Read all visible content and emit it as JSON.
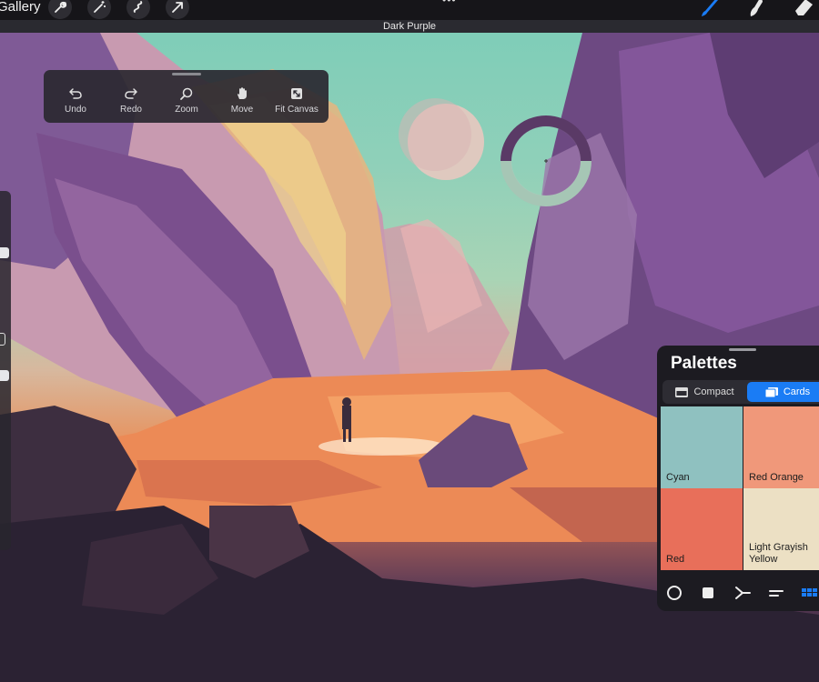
{
  "app": {
    "gallery_label": "Gallery",
    "layer_name": "Dark Purple",
    "more_label": "•••"
  },
  "topbar": {
    "left_tools": [
      "wrench-icon",
      "magic-wand-icon",
      "selection-icon",
      "transform-arrow-icon"
    ],
    "right_tools": [
      "brush-icon",
      "smudge-icon",
      "eraser-icon"
    ],
    "active_tool": "brush-icon",
    "accent_color": "#1a7cf5"
  },
  "quickbar": {
    "items": [
      {
        "label": "Undo",
        "icon": "undo-icon"
      },
      {
        "label": "Redo",
        "icon": "redo-icon"
      },
      {
        "label": "Zoom",
        "icon": "zoom-icon"
      },
      {
        "label": "Move",
        "icon": "hand-icon"
      },
      {
        "label": "Fit Canvas",
        "icon": "fit-canvas-icon"
      }
    ]
  },
  "color_picker": {
    "current_color": "#5a3a66",
    "previous_color": "#a6c6b5"
  },
  "palettes": {
    "title": "Palettes",
    "tabs": [
      {
        "label": "Compact",
        "active": false
      },
      {
        "label": "Cards",
        "active": true
      }
    ],
    "swatches": [
      {
        "name": "Cyan",
        "color": "#8fc1c0"
      },
      {
        "name": "Red Orange",
        "color": "#f0987a"
      },
      {
        "name": "Red",
        "color": "#e86f5a"
      },
      {
        "name": "Light Grayish Yellow",
        "color": "#ece0c4"
      }
    ],
    "tools": [
      "disc-icon",
      "classic-icon",
      "harmony-icon",
      "value-icon",
      "palettes-icon"
    ],
    "active_tool": "palettes-icon"
  }
}
